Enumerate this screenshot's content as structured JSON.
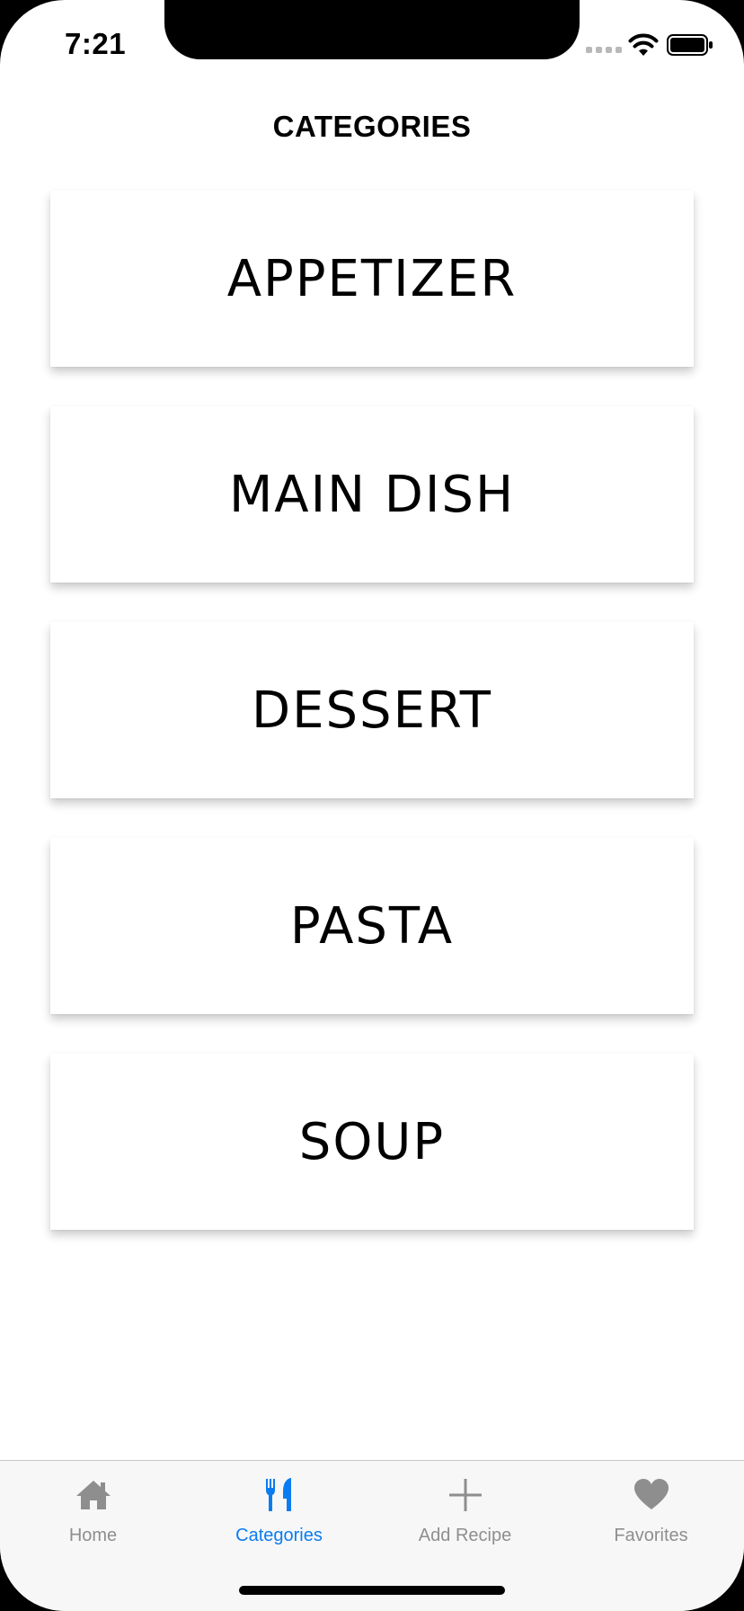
{
  "status_bar": {
    "time": "7:21"
  },
  "header": {
    "title": "CATEGORIES"
  },
  "categories": [
    {
      "label": "APPETIZER"
    },
    {
      "label": "MAIN DISH"
    },
    {
      "label": "DESSERT"
    },
    {
      "label": "PASTA"
    },
    {
      "label": "SOUP"
    }
  ],
  "tabbar": {
    "active_color": "#0a7cf0",
    "inactive_color": "#8e8e8e",
    "tabs": [
      {
        "label": "Home",
        "icon": "home-icon",
        "active": false
      },
      {
        "label": "Categories",
        "icon": "cutlery-icon",
        "active": true
      },
      {
        "label": "Add Recipe",
        "icon": "plus-icon",
        "active": false
      },
      {
        "label": "Favorites",
        "icon": "heart-icon",
        "active": false
      }
    ]
  }
}
